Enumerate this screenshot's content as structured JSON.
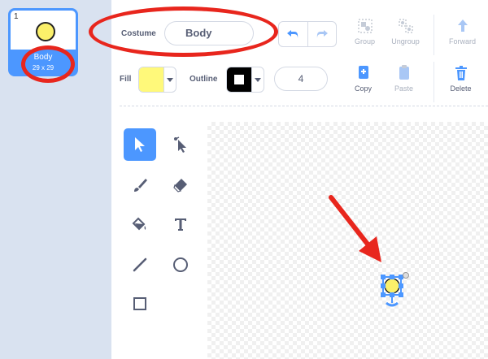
{
  "sidebar": {
    "costume": {
      "number": "1",
      "name": "Body",
      "size": "29 x 29"
    }
  },
  "toolbar": {
    "costume_label": "Costume",
    "costume_name_value": "Body",
    "group_label": "Group",
    "ungroup_label": "Ungroup",
    "forward_label": "Forward",
    "fill_label": "Fill",
    "outline_label": "Outline",
    "outline_width": "4",
    "copy_label": "Copy",
    "paste_label": "Paste",
    "delete_label": "Delete"
  },
  "colors": {
    "accent": "#4c97ff",
    "fill": "#fff97a",
    "outline": "#000000",
    "annotation": "#e8261d"
  }
}
